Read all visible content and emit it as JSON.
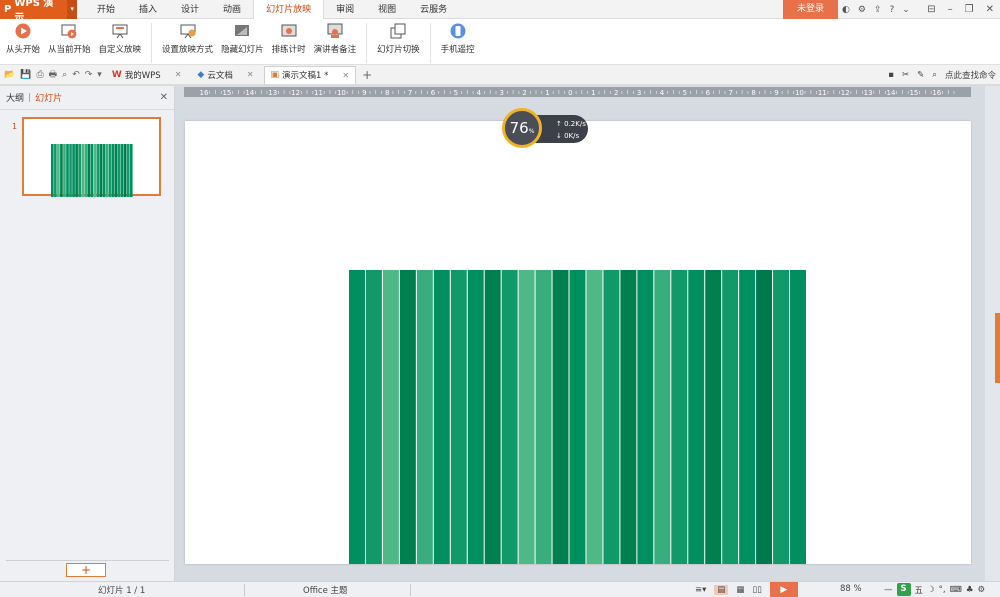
{
  "app": {
    "name": "WPS 演示",
    "logo": "P",
    "menu_tabs": [
      "开始",
      "插入",
      "设计",
      "动画",
      "幻灯片放映",
      "审阅",
      "视图",
      "云服务"
    ],
    "active_tab": "幻灯片放映",
    "login_label": "未登录",
    "accent": "#e15d1c"
  },
  "ribbon": {
    "buttons": [
      {
        "label": "从头开始",
        "icon": "play-circle-icon"
      },
      {
        "label": "从当前开始",
        "icon": "play-from-current-icon"
      },
      {
        "label": "自定义放映",
        "icon": "custom-show-icon"
      },
      {
        "label": "设置放映方式",
        "icon": "setup-show-icon"
      },
      {
        "label": "隐藏幻灯片",
        "icon": "hide-slide-icon"
      },
      {
        "label": "排练计时",
        "icon": "rehearse-timing-icon"
      },
      {
        "label": "演讲者备注",
        "icon": "speaker-notes-icon"
      },
      {
        "label": "幻灯片切换",
        "icon": "slide-transition-icon"
      },
      {
        "label": "手机遥控",
        "icon": "phone-remote-icon"
      }
    ]
  },
  "doc_tabs": [
    {
      "label": "我的WPS",
      "icon": "wps-icon"
    },
    {
      "label": "云文档",
      "icon": "cloud-doc-icon"
    },
    {
      "label": "演示文稿1 *",
      "icon": "presentation-icon",
      "active": true
    }
  ],
  "search_cmd": "点此查找命令",
  "left_pane": {
    "tab_outline": "大纲",
    "tab_slides": "幻灯片",
    "slide_number": "1",
    "add_label": "+"
  },
  "ruler_labels": [
    "16",
    "15",
    "14",
    "13",
    "12",
    "11",
    "10",
    "9",
    "8",
    "7",
    "6",
    "5",
    "4",
    "3",
    "2",
    "1",
    "0",
    "1",
    "2",
    "3",
    "4",
    "5",
    "6",
    "7",
    "8",
    "9",
    "10",
    "11",
    "12",
    "13",
    "14",
    "15",
    "16"
  ],
  "net_widget": {
    "percent": "76",
    "percent_unit": "%",
    "upload": "0.2",
    "upload_unit": "K/s",
    "download": "0",
    "download_unit": "K/s"
  },
  "stripe_colors": [
    "#009060",
    "#12996a",
    "#4fb887",
    "#00804f",
    "#3aad7e",
    "#009060",
    "#12996a",
    "#009060",
    "#00804f",
    "#12996a",
    "#4fb887",
    "#3aad7e",
    "#00804f",
    "#009060",
    "#4fb887",
    "#12996a",
    "#00804f",
    "#009060",
    "#3aad7e",
    "#12996a",
    "#009060",
    "#00804f",
    "#12996a",
    "#009060",
    "#007a4c",
    "#12996a",
    "#009060"
  ],
  "status": {
    "slide_info": "幻灯片 1 / 1",
    "theme": "Office 主题",
    "zoom": "88 %",
    "ime_char": "五",
    "ime_logo": "S"
  }
}
